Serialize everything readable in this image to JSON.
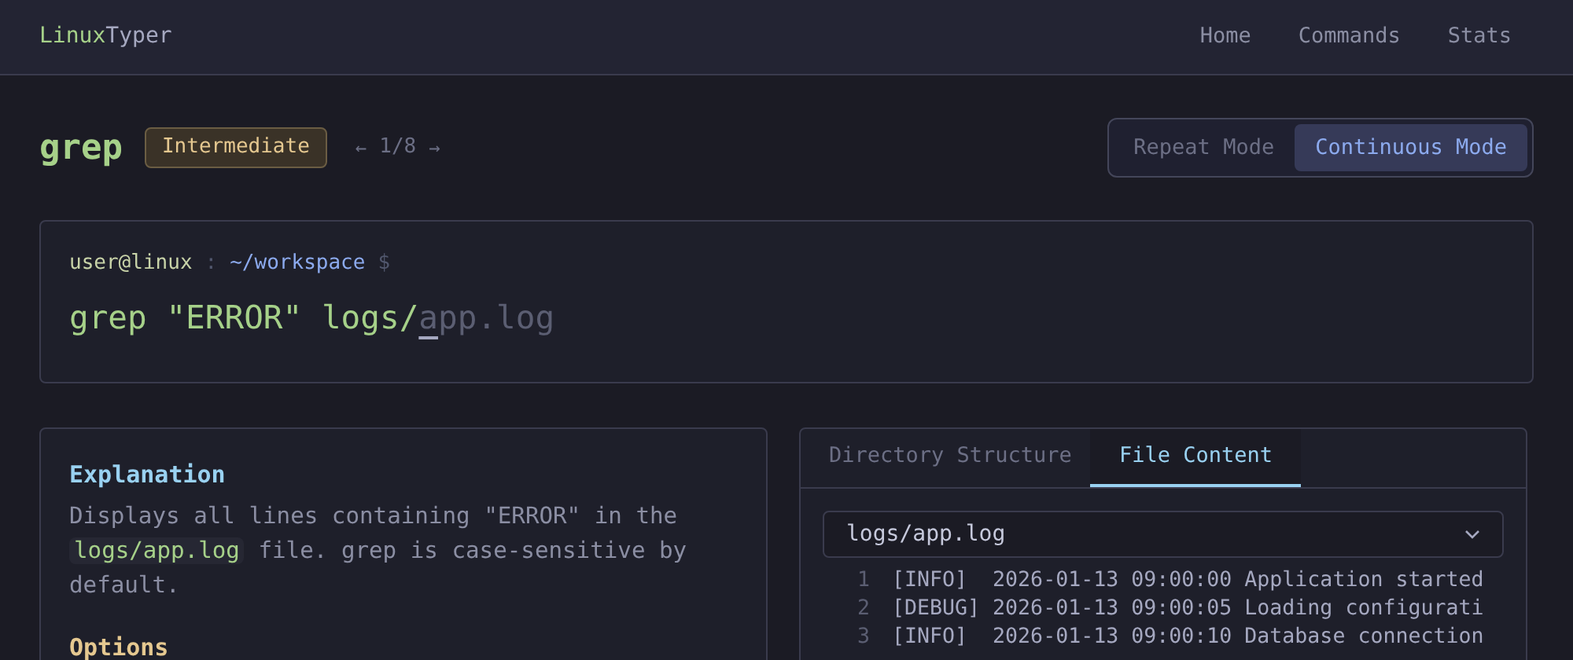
{
  "brand": {
    "first": "Linux",
    "second": "Typer"
  },
  "nav": [
    {
      "label": "Home"
    },
    {
      "label": "Commands"
    },
    {
      "label": "Stats"
    }
  ],
  "command": {
    "name": "grep",
    "level": "Intermediate",
    "prev": "←",
    "position": "1/8",
    "next": "→"
  },
  "modes": [
    {
      "label": "Repeat Mode",
      "selected": false
    },
    {
      "label": "Continuous Mode",
      "selected": true
    }
  ],
  "terminal": {
    "user": "user@linux",
    "separator": ":",
    "path": "~/workspace",
    "prompt": "$",
    "typed": "grep \"ERROR\" logs/",
    "remaining": "app.log"
  },
  "explanation": {
    "title": "Explanation",
    "parts": [
      {
        "kind": "text",
        "text": "Displays all lines containing \"ERROR\" in the "
      },
      {
        "kind": "code",
        "text": "logs/app.log"
      },
      {
        "kind": "text",
        "text": " file. grep is case-sensitive by default."
      }
    ]
  },
  "options": {
    "title": "Options"
  },
  "tabs": [
    {
      "label": "Directory Structure",
      "selected": false
    },
    {
      "label": "File Content",
      "selected": true
    }
  ],
  "file_select": {
    "value": "logs/app.log"
  },
  "file_lines": [
    {
      "number": "1",
      "text": "[INFO]  2026-01-13 09:00:00 Application started"
    },
    {
      "number": "2",
      "text": "[DEBUG] 2026-01-13 09:00:05 Loading configurati"
    },
    {
      "number": "3",
      "text": "[INFO]  2026-01-13 09:00:10 Database connection"
    }
  ]
}
